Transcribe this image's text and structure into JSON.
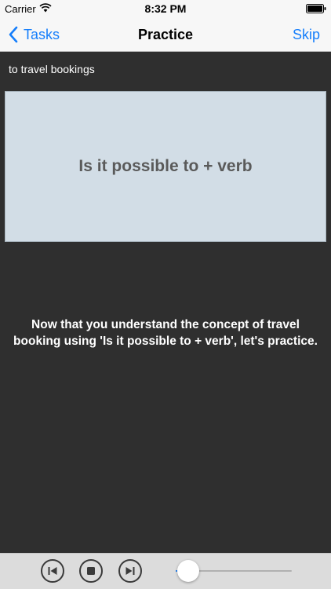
{
  "status_bar": {
    "carrier": "Carrier",
    "time": "8:32 PM",
    "wifi_icon": "wifi-icon",
    "battery_icon": "battery-icon"
  },
  "nav": {
    "back_label": "Tasks",
    "back_icon": "chevron-left-icon",
    "title": "Practice",
    "skip_label": "Skip"
  },
  "lesson": {
    "subtitle": "to travel bookings",
    "card_text": "Is it possible to + verb",
    "instruction": "Now that you understand the concept of travel booking using 'Is it possible to + verb', let's practice."
  },
  "player": {
    "prev_icon": "skip-previous-icon",
    "stop_icon": "stop-icon",
    "next_icon": "skip-next-icon",
    "progress": 0.1
  },
  "colors": {
    "accent": "#157efb",
    "background": "#2f2f2f",
    "card": "#d2dde6",
    "bar": "#f7f7f7"
  }
}
